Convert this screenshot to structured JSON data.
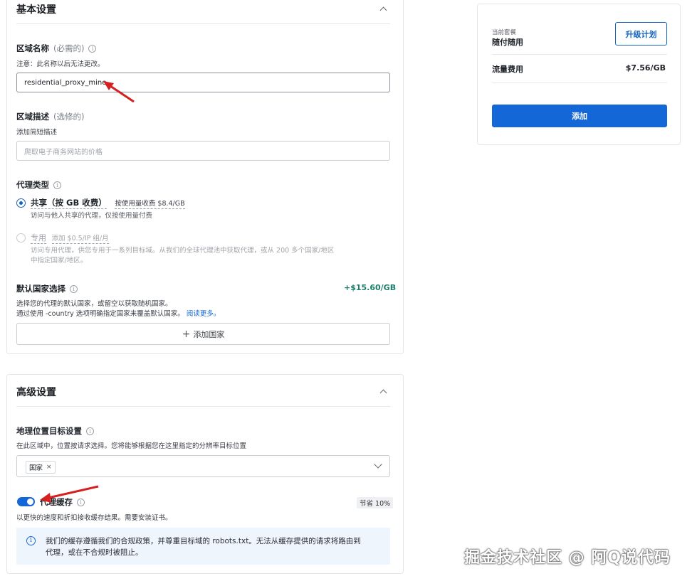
{
  "basic": {
    "title": "基本设置",
    "zone_name": {
      "label": "区域名称",
      "optional": "(必需的)",
      "note": "注意：此名称以后无法更改。",
      "value": "residential_proxy_mine"
    },
    "zone_desc": {
      "label": "区域描述",
      "optional": "(选修的)",
      "note": "添加简短描述",
      "placeholder": "爬取电子商务网站的价格"
    },
    "proxy_type": {
      "label": "代理类型",
      "shared_title": "共享（按 GB 收费）",
      "shared_price": "按使用量收费 $8.4/GB",
      "shared_desc": "访问与他人共享的代理，仅按使用量付费",
      "dedicated_title": "专用",
      "dedicated_price": "添加 $0.5/IP 组/月",
      "dedicated_desc_1": "访问专用代理，供您专用于一系列目标域。从我们的全球代理池中获取代理，或从 200 多个国家/地区",
      "dedicated_desc_2": "中指定国家/地区。"
    },
    "country": {
      "label": "默认国家选择",
      "price": "+$15.60/GB",
      "desc_1": "选择您的代理的默认国家，或留空以获取随机国家。",
      "desc_2": "通过使用 -country 选项明确指定国家来覆盖默认国家。",
      "read_more": "阅读更多。",
      "add_button": "添加国家"
    }
  },
  "advanced": {
    "title": "高级设置",
    "geo": {
      "label": "地理位置目标设置",
      "desc": "在此区域中，位置按请求选择。您将能够根据您在这里指定的分辨率目标位置",
      "chip": "国家"
    },
    "cache": {
      "label": "代理缓存",
      "badge": "节省 10%",
      "desc": "以更快的速度和折扣接收缓存结果。需要安装证书。",
      "notice_1": "我们的缓存遵循我们的合规政策，并尊重目标域的 robots.txt。无法从缓存提供的请求将路由到",
      "notice_2": "代理，或在不合规时被阻止。"
    }
  },
  "plan": {
    "current_label": "当前套餐",
    "current_value": "随付随用",
    "upgrade_button": "升级计划",
    "traffic_label": "流量费用",
    "traffic_value": "$7.56/GB",
    "add_button": "添加"
  },
  "watermark": "掘金技术社区 @ 阿Q说代码",
  "colors": {
    "primary": "#1467d6",
    "positive": "#1b7f6b",
    "annotation_arrow": "#d62020"
  },
  "icons": [
    "chevron-up-icon",
    "info-icon",
    "plus-icon",
    "close-icon",
    "chevron-down-icon",
    "arrow-annotation-icon"
  ]
}
